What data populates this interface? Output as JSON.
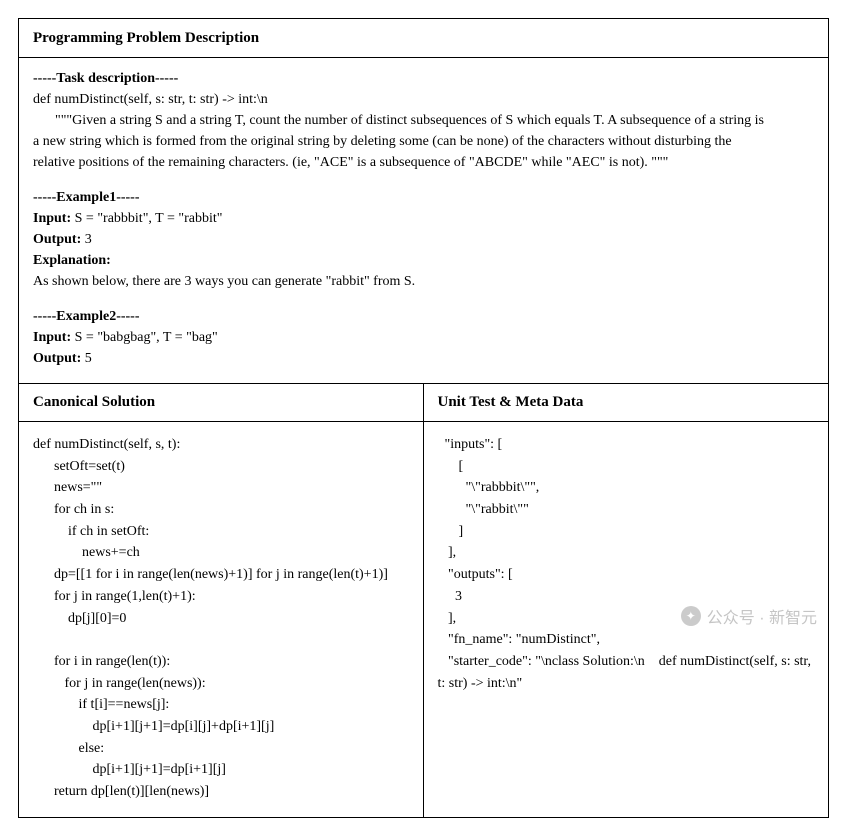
{
  "header": {
    "title": "Programming Problem Description"
  },
  "task": {
    "marker": "-----Task description-----",
    "signature": "def numDistinct(self, s: str, t: str) -> int:\\n",
    "docstring_line1": "\"\"\"Given a string S and a string T, count the number of distinct subsequences of S which equals T. A subsequence of a string is",
    "docstring_line2": "a new string which is formed from the original string by deleting some (can be none) of the characters without disturbing the",
    "docstring_line3": "relative positions of the remaining characters. (ie, \"ACE\" is a subsequence of \"ABCDE\" while \"AEC\" is not). \"\"\""
  },
  "example1": {
    "marker": "-----Example1-----",
    "input_label": "Input:",
    "input_value": " S = \"rabbbit\", T = \"rabbit\"",
    "output_label": "Output:",
    "output_value": " 3",
    "explanation_label": "Explanation:",
    "explanation_text": "As shown below, there are 3 ways you can generate \"rabbit\" from S."
  },
  "example2": {
    "marker": "-----Example2-----",
    "input_label": "Input:",
    "input_value": " S = \"babgbag\", T = \"bag\"",
    "output_label": "Output:",
    "output_value": " 5"
  },
  "solution": {
    "header": "Canonical Solution",
    "code": "def numDistinct(self, s, t):\n      setOft=set(t)\n      news=\"\"\n      for ch in s:\n          if ch in setOft:\n              news+=ch\n      dp=[[1 for i in range(len(news)+1)] for j in range(len(t)+1)]\n      for j in range(1,len(t)+1):\n          dp[j][0]=0\n\n      for i in range(len(t)):\n         for j in range(len(news)):\n             if t[i]==news[j]:\n                 dp[i+1][j+1]=dp[i][j]+dp[i+1][j]\n             else:\n                 dp[i+1][j+1]=dp[i+1][j]\n      return dp[len(t)][len(news)]"
  },
  "testdata": {
    "header": "Unit Test & Meta Data",
    "lines": [
      "  \"inputs\": [",
      "      [",
      "        \"\\\"rabbbit\\\"\",",
      "        \"\\\"rabbit\\\"\"",
      "      ]",
      "   ],",
      "   \"outputs\": [",
      "     3",
      "   ],",
      "   \"fn_name\": \"numDistinct\",",
      "   \"starter_code\": \"\\nclass Solution:\\n    def numDistinct(self, s: str,",
      "t: str) -> int:\\n\""
    ]
  },
  "watermark": {
    "text": "公众号 · 新智元"
  }
}
